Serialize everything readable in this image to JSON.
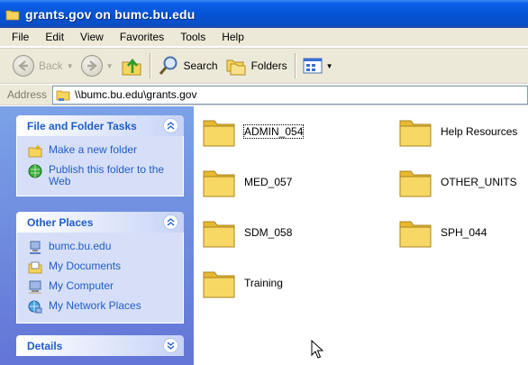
{
  "window": {
    "title": "grants.gov on bumc.bu.edu",
    "icon": "folder-icon"
  },
  "menu": [
    "File",
    "Edit",
    "View",
    "Favorites",
    "Tools",
    "Help"
  ],
  "toolbar": {
    "back_label": "Back",
    "search_label": "Search",
    "folders_label": "Folders"
  },
  "address": {
    "label": "Address",
    "value": "\\\\bumc.bu.edu\\grants.gov"
  },
  "tasks": {
    "file_folder": {
      "title": "File and Folder Tasks",
      "items": [
        {
          "label": "Make a new folder",
          "icon": "new-folder-icon"
        },
        {
          "label": "Publish this folder to the Web",
          "icon": "publish-web-icon"
        }
      ]
    },
    "other_places": {
      "title": "Other Places",
      "items": [
        {
          "label": "bumc.bu.edu",
          "icon": "network-computer-icon"
        },
        {
          "label": "My Documents",
          "icon": "my-documents-icon"
        },
        {
          "label": "My Computer",
          "icon": "my-computer-icon"
        },
        {
          "label": "My Network Places",
          "icon": "network-places-icon"
        }
      ]
    },
    "details": {
      "title": "Details"
    }
  },
  "folders": [
    {
      "name": "ADMIN_054",
      "selected": true
    },
    {
      "name": "Help Resources"
    },
    {
      "name": "MED_057"
    },
    {
      "name": "OTHER_UNITS"
    },
    {
      "name": "SDM_058"
    },
    {
      "name": "SPH_044"
    },
    {
      "name": "Training"
    }
  ],
  "colors": {
    "title_bar": "#0654d6",
    "task_pane": "#6f8de0",
    "link": "#215dc6",
    "folder": "#f6d55c"
  }
}
